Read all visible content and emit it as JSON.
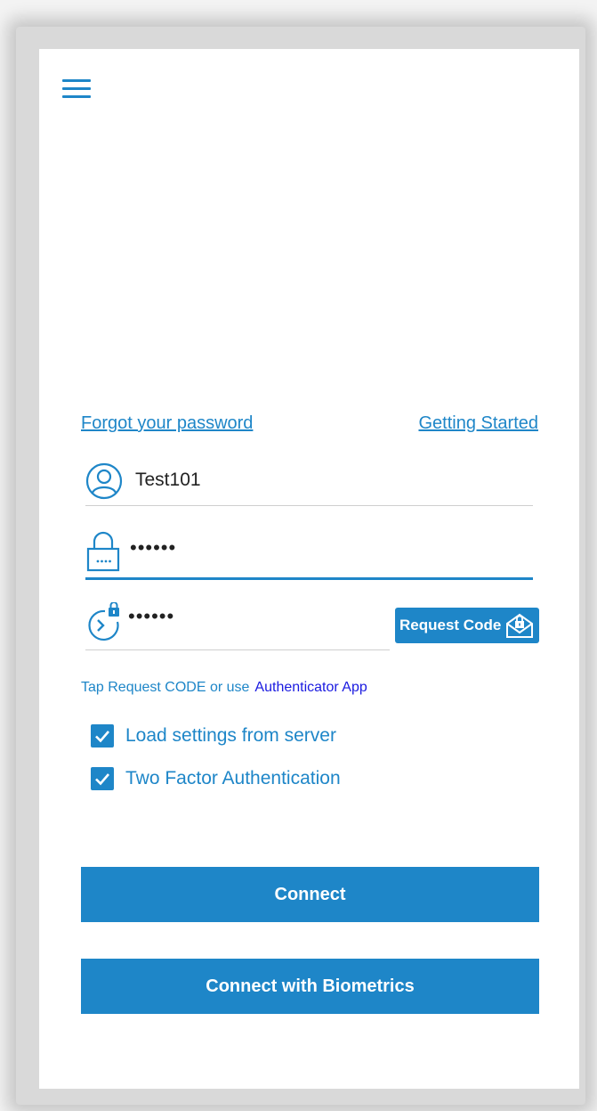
{
  "links": {
    "forgot_password": "Forgot your password",
    "getting_started": "Getting Started"
  },
  "username": {
    "value": "Test101"
  },
  "password": {
    "value": "••••••"
  },
  "code": {
    "value": "••••••"
  },
  "request_code": {
    "label": "Request Code"
  },
  "hint": {
    "text": "Tap Request CODE or use",
    "link": "Authenticator App"
  },
  "options": [
    {
      "label": "Load settings from server",
      "checked": true
    },
    {
      "label": "Two Factor Authentication",
      "checked": true
    }
  ],
  "buttons": {
    "connect": "Connect",
    "connect_biometrics": "Connect with Biometrics"
  },
  "colors": {
    "accent": "#1e86c8",
    "link_app": "#1a1ae0"
  },
  "icons": [
    "menu-icon",
    "user-icon",
    "lock-icon",
    "timer-lock-icon",
    "mail-lock-icon",
    "check-icon"
  ]
}
